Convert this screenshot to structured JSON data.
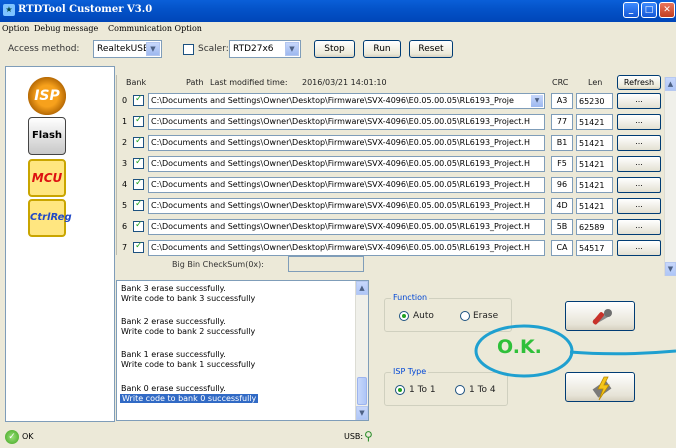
{
  "window": {
    "title": "RTDTool Customer V3.0"
  },
  "menu": [
    "Option",
    "Debug message",
    "Communication Option"
  ],
  "toolbar": {
    "access_label": "Access method:",
    "access_value": "RealtekUSB",
    "scaler_label": "Scaler:",
    "scaler_checked": false,
    "scaler_value": "RTD27x6",
    "stop": "Stop",
    "run": "Run",
    "reset": "Reset"
  },
  "left_tools": [
    {
      "name": "isp-tool-icon",
      "text": "ISP"
    },
    {
      "name": "flash-tool-icon",
      "text": "Flash"
    },
    {
      "name": "mcu-tool-icon",
      "text": "MCU"
    },
    {
      "name": "ctrlreg-tool-icon",
      "text": "CtrlReg"
    }
  ],
  "bank_header": {
    "bank": "Bank",
    "path": "Path",
    "last_modified_label": "Last modified time:",
    "last_modified_value": "2016/03/21 14:01:10",
    "crc": "CRC",
    "len": "Len",
    "refresh": "Refresh"
  },
  "banks": [
    {
      "num": "0",
      "checked": true,
      "path": "C:\\Documents and Settings\\Owner\\Desktop\\Firmware\\SVX-4096\\E0.05.00.05\\RL6193_Proje",
      "crc": "A3",
      "len": "65230",
      "browse": "..."
    },
    {
      "num": "1",
      "checked": true,
      "path": "C:\\Documents and Settings\\Owner\\Desktop\\Firmware\\SVX-4096\\E0.05.00.05\\RL6193_Project.H",
      "crc": "77",
      "len": "51421",
      "browse": "..."
    },
    {
      "num": "2",
      "checked": true,
      "path": "C:\\Documents and Settings\\Owner\\Desktop\\Firmware\\SVX-4096\\E0.05.00.05\\RL6193_Project.H",
      "crc": "B1",
      "len": "51421",
      "browse": "..."
    },
    {
      "num": "3",
      "checked": true,
      "path": "C:\\Documents and Settings\\Owner\\Desktop\\Firmware\\SVX-4096\\E0.05.00.05\\RL6193_Project.H",
      "crc": "F5",
      "len": "51421",
      "browse": "..."
    },
    {
      "num": "4",
      "checked": true,
      "path": "C:\\Documents and Settings\\Owner\\Desktop\\Firmware\\SVX-4096\\E0.05.00.05\\RL6193_Project.H",
      "crc": "96",
      "len": "51421",
      "browse": "..."
    },
    {
      "num": "5",
      "checked": true,
      "path": "C:\\Documents and Settings\\Owner\\Desktop\\Firmware\\SVX-4096\\E0.05.00.05\\RL6193_Project.H",
      "crc": "4D",
      "len": "51421",
      "browse": "..."
    },
    {
      "num": "6",
      "checked": true,
      "path": "C:\\Documents and Settings\\Owner\\Desktop\\Firmware\\SVX-4096\\E0.05.00.05\\RL6193_Project.H",
      "crc": "5B",
      "len": "62589",
      "browse": "..."
    },
    {
      "num": "7",
      "checked": true,
      "path": "C:\\Documents and Settings\\Owner\\Desktop\\Firmware\\SVX-4096\\E0.05.00.05\\RL6193_Project.H",
      "crc": "CA",
      "len": "54517",
      "browse": "..."
    }
  ],
  "checksum": {
    "label": "Big Bin CheckSum(0x):",
    "value": ""
  },
  "log": [
    "Bank 3 erase successfully.",
    "Write code to bank 3 successfully",
    "",
    "Bank 2 erase successfully.",
    "Write code to bank 2 successfully",
    "",
    "Bank 1 erase successfully.",
    "Write code to bank 1 successfully",
    "",
    "Bank 0 erase successfully.",
    "Write code to bank 0 successfully"
  ],
  "function_group": {
    "title": "Function",
    "auto": "Auto",
    "erase": "Erase",
    "selected": "Auto"
  },
  "isp_type_group": {
    "title": "ISP Type",
    "one_to_one": "1 To 1",
    "one_to_four": "1 To 4",
    "selected": "1 To 1"
  },
  "annotation": {
    "text": "O.K.",
    "color": "#1fa0d0",
    "text_color": "#2fc03a"
  },
  "status": {
    "ok": "OK",
    "usb": "USB:"
  },
  "colors": {
    "title_bar": "#0453c9",
    "selection": "#316ac5",
    "group_title": "#0046d5"
  }
}
